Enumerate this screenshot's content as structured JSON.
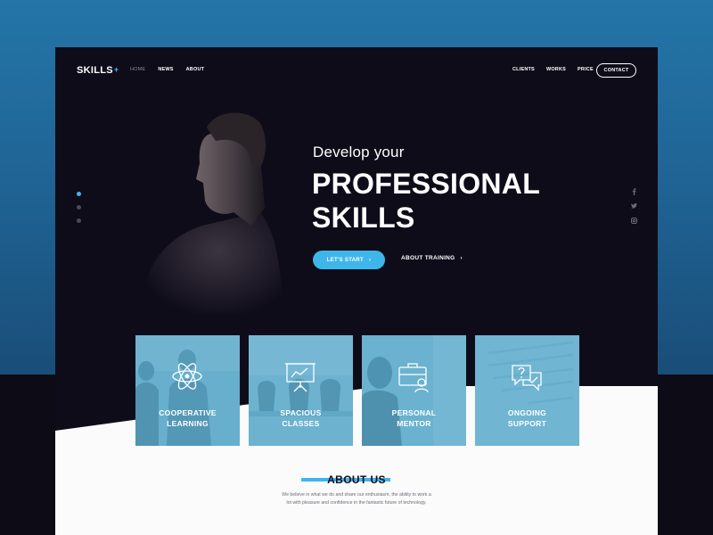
{
  "brand": {
    "name": "SKILLS",
    "mark": "+"
  },
  "nav": {
    "left": [
      "HOME",
      "NEWS",
      "ABOUT"
    ],
    "right": [
      "CLIENTS",
      "WORKS",
      "PRICE"
    ],
    "contact": "CONTACT",
    "active": "HOME"
  },
  "hero": {
    "subtitle": "Develop your",
    "title_line1": "PROFESSIONAL",
    "title_line2": "SKILLS",
    "cta_primary": "LET'S START",
    "cta_secondary": "ABOUT TRAINING",
    "arrow": "›"
  },
  "slider": {
    "slides": 3,
    "active": 1
  },
  "social": [
    "facebook-icon",
    "twitter-icon",
    "instagram-icon"
  ],
  "cards": [
    {
      "line1": "COOPERATIVE",
      "line2": "LEARNING",
      "icon": "atom-icon"
    },
    {
      "line1": "SPACIOUS",
      "line2": "CLASSES",
      "icon": "presentation-board-icon"
    },
    {
      "line1": "PERSONAL",
      "line2": "MENTOR",
      "icon": "briefcase-mentor-icon"
    },
    {
      "line1": "ONGOING",
      "line2": "SUPPORT",
      "icon": "chat-bubbles-icon"
    }
  ],
  "about": {
    "title": "ABOUT US",
    "text_line1": "We believe in what we do and share our enthusiasm, the ability to work a",
    "text_line2": "lot with pleasure and confidence in the fantastic future of technology."
  },
  "colors": {
    "accent": "#3fb6ea",
    "hero_bg": "#0f0c1a",
    "card_tint": "#5cacd",
    "backdrop": "#1f6394"
  }
}
